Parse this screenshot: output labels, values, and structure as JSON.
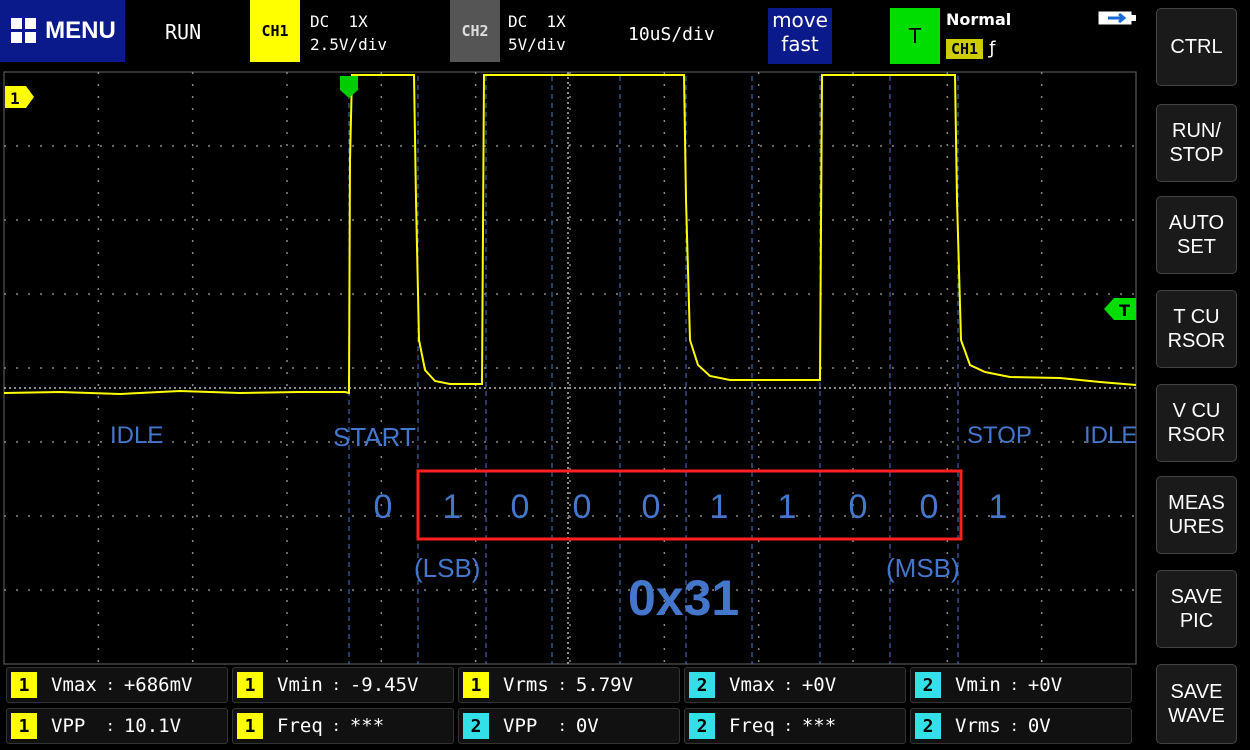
{
  "top": {
    "menu_label": "MENU",
    "run_status": "RUN",
    "ch1": {
      "badge": "CH1",
      "coupling": "DC  1X",
      "scale": "2.5V/div"
    },
    "ch2": {
      "badge": "CH2",
      "coupling": "DC  1X",
      "scale": "5V/div"
    },
    "timebase": "10uS/div",
    "move_line1": "move",
    "move_line2": "fast",
    "trigger": {
      "badge": "T",
      "mode": "Normal",
      "source": "CH1",
      "edge": "ƒ"
    }
  },
  "side_buttons": [
    {
      "line1": "CTRL",
      "line2": ""
    },
    {
      "line1": "RUN/",
      "line2": "STOP"
    },
    {
      "line1": "AUTO",
      "line2": "SET"
    },
    {
      "line1": "T CU",
      "line2": "RSOR"
    },
    {
      "line1": "V CU",
      "line2": "RSOR"
    },
    {
      "line1": "MEAS",
      "line2": "URES"
    },
    {
      "line1": "SAVE",
      "line2": "PIC"
    },
    {
      "line1": "SAVE",
      "line2": "WAVE"
    }
  ],
  "markers": {
    "ch1_marker": "1",
    "trigger_marker": "T"
  },
  "annotations": {
    "idle_left": "IDLE",
    "start": "START",
    "stop": "STOP",
    "idle_right": "IDLE",
    "bits": [
      "0",
      "1",
      "0",
      "0",
      "0",
      "1",
      "1",
      "0",
      "0",
      "1"
    ],
    "lsb": "(LSB)",
    "msb": "(MSB)",
    "value": "0x31"
  },
  "measurements": [
    [
      {
        "ch": "1",
        "label": "Vmax",
        "value": "+686mV"
      },
      {
        "ch": "1",
        "label": "Vmin",
        "value": "-9.45V"
      },
      {
        "ch": "1",
        "label": "Vrms",
        "value": "5.79V"
      },
      {
        "ch": "2",
        "label": "Vmax",
        "value": "+0V"
      },
      {
        "ch": "2",
        "label": "Vmin",
        "value": "+0V"
      }
    ],
    [
      {
        "ch": "1",
        "label": "VPP ",
        "value": "10.1V"
      },
      {
        "ch": "1",
        "label": "Freq",
        "value": "***"
      },
      {
        "ch": "2",
        "label": "VPP ",
        "value": "0V"
      },
      {
        "ch": "2",
        "label": "Freq",
        "value": "***"
      },
      {
        "ch": "2",
        "label": "Vrms",
        "value": "0V"
      }
    ]
  ],
  "colors": {
    "trace": "#ffff00",
    "ch2": "#33e0e8",
    "annotation": "#4477cc",
    "highlight_box": "#ff2020",
    "trigger": "#00dd00"
  }
}
